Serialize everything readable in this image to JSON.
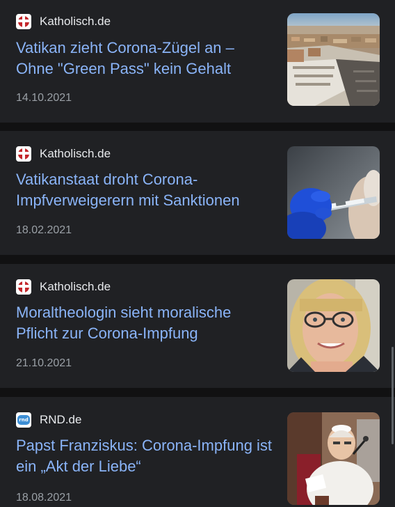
{
  "feed": {
    "articles": [
      {
        "source": "Katholisch.de",
        "favicon": "katholisch-favicon",
        "headline": "Vatikan zieht Corona-Zügel an – Ohne \"Green Pass\" kein Gehalt",
        "date": "14.10.2021",
        "thumbnail": "aerial-city-thumbnail"
      },
      {
        "source": "Katholisch.de",
        "favicon": "katholisch-favicon",
        "headline": "Vatikanstaat droht Corona-Impfverweigerern mit Sanktionen",
        "date": "18.02.2021",
        "thumbnail": "vaccine-syringe-thumbnail"
      },
      {
        "source": "Katholisch.de",
        "favicon": "katholisch-favicon",
        "headline": "Moraltheologin sieht moralische Pflicht zur Corona-Impfung",
        "date": "21.10.2021",
        "thumbnail": "woman-portrait-thumbnail"
      },
      {
        "source": "RND.de",
        "favicon": "rnd-favicon",
        "favicon_text": "rnd",
        "headline": "Papst Franziskus: Corona-Impfung ist ein „Akt der Liebe“",
        "date": "18.08.2021",
        "thumbnail": "pope-portrait-thumbnail"
      }
    ]
  },
  "colors": {
    "background": "#111112",
    "card": "#202124",
    "headline": "#8ab4f8",
    "source": "#e8eaed",
    "date": "#9aa0a6",
    "katholisch_red": "#c3272b",
    "rnd_blue": "#3d8fd6"
  }
}
